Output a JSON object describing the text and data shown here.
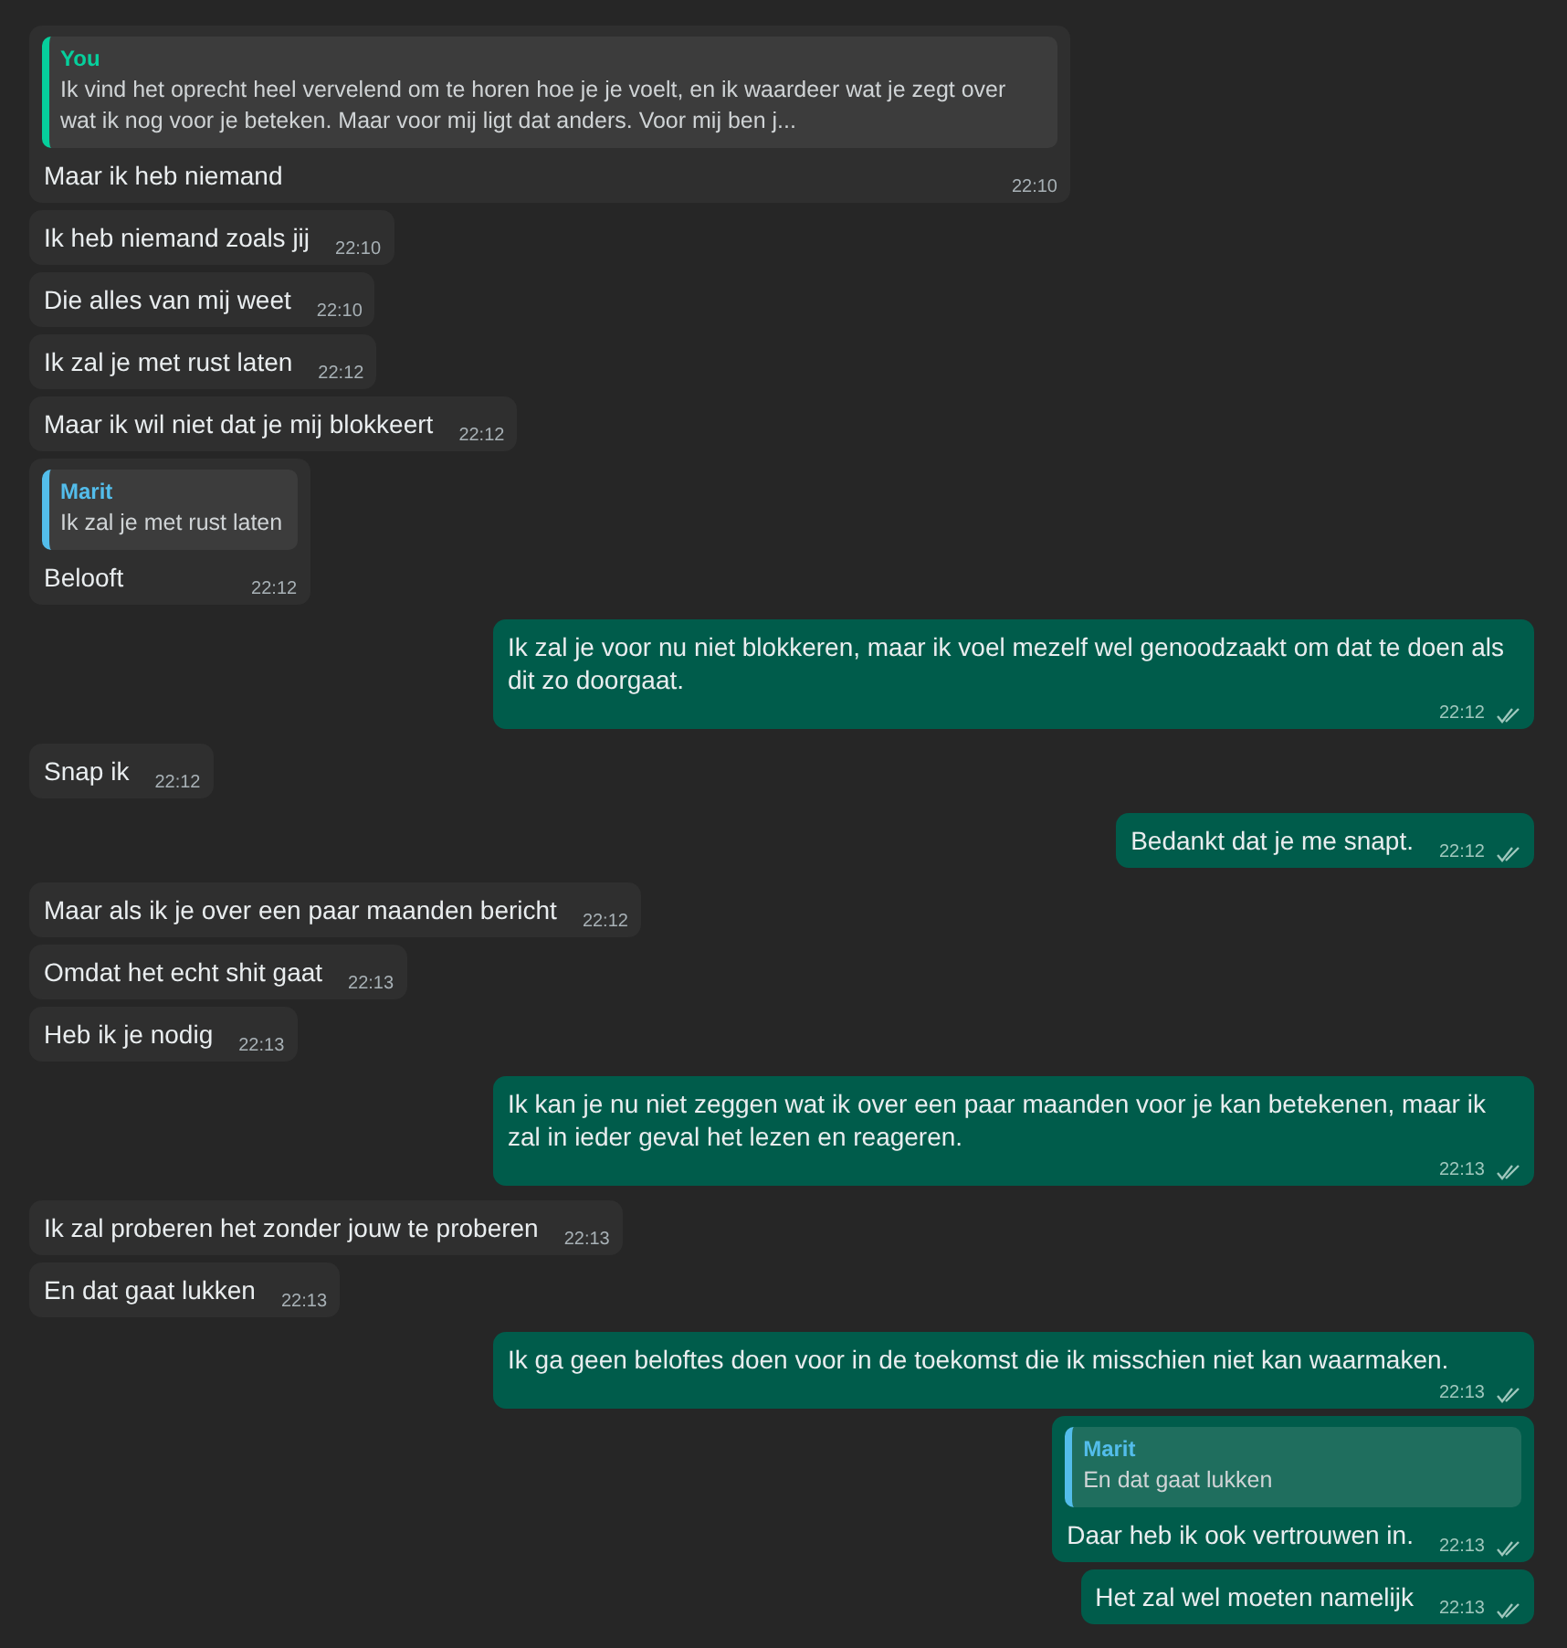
{
  "messages": [
    {
      "kind": "incoming",
      "quote": {
        "author": "You",
        "color": "#06cf9c",
        "text": "Ik vind het oprecht heel vervelend om te horen hoe je je voelt, en ik waardeer wat je zegt over wat ik nog voor je beteken. Maar voor mij ligt dat anders. Voor mij ben j..."
      },
      "text": "Maar ik heb niemand",
      "time": "22:10"
    },
    {
      "kind": "incoming",
      "text": "Ik heb niemand zoals jij",
      "time": "22:10"
    },
    {
      "kind": "incoming",
      "text": "Die alles van mij weet",
      "time": "22:10"
    },
    {
      "kind": "incoming",
      "text": "Ik zal je met rust laten",
      "time": "22:12"
    },
    {
      "kind": "incoming",
      "text": "Maar ik wil niet dat je mij blokkeert",
      "time": "22:12"
    },
    {
      "kind": "incoming",
      "quote": {
        "author": "Marit",
        "color": "#53bdeb",
        "text": "Ik zal je met rust laten"
      },
      "text": "Belooft",
      "time": "22:12"
    },
    {
      "kind": "outgoing",
      "text": "Ik zal je voor nu niet blokkeren, maar ik voel mezelf wel genoodzaakt om dat te doen als dit zo doorgaat.",
      "time": "22:12",
      "delivered": true
    },
    {
      "kind": "incoming",
      "text": "Snap ik",
      "time": "22:12"
    },
    {
      "kind": "outgoing",
      "text": "Bedankt dat je me snapt.",
      "time": "22:12",
      "delivered": true
    },
    {
      "kind": "incoming",
      "text": "Maar als ik je over een paar maanden bericht",
      "time": "22:12"
    },
    {
      "kind": "incoming",
      "text": "Omdat het echt shit gaat",
      "time": "22:13"
    },
    {
      "kind": "incoming",
      "text": "Heb ik je nodig",
      "time": "22:13"
    },
    {
      "kind": "outgoing",
      "text": "Ik kan je nu niet zeggen wat ik over een paar maanden voor je kan betekenen, maar ik zal in ieder geval het lezen en reageren.",
      "time": "22:13",
      "delivered": true
    },
    {
      "kind": "incoming",
      "text": "Ik zal proberen het zonder jouw te proberen",
      "time": "22:13"
    },
    {
      "kind": "incoming",
      "text": "En dat gaat lukken",
      "time": "22:13"
    },
    {
      "kind": "outgoing",
      "text": "Ik ga geen beloftes doen voor in de toekomst die ik misschien niet kan waarmaken.",
      "time": "22:13",
      "delivered": true
    },
    {
      "kind": "outgoing",
      "quote": {
        "author": "Marit",
        "color": "#53bdeb",
        "text": "En dat gaat lukken"
      },
      "text": "Daar heb ik ook vertrouwen in.",
      "time": "22:13",
      "delivered": true
    },
    {
      "kind": "outgoing",
      "text": "Het zal wel moeten namelijk",
      "time": "22:13",
      "delivered": true
    }
  ]
}
